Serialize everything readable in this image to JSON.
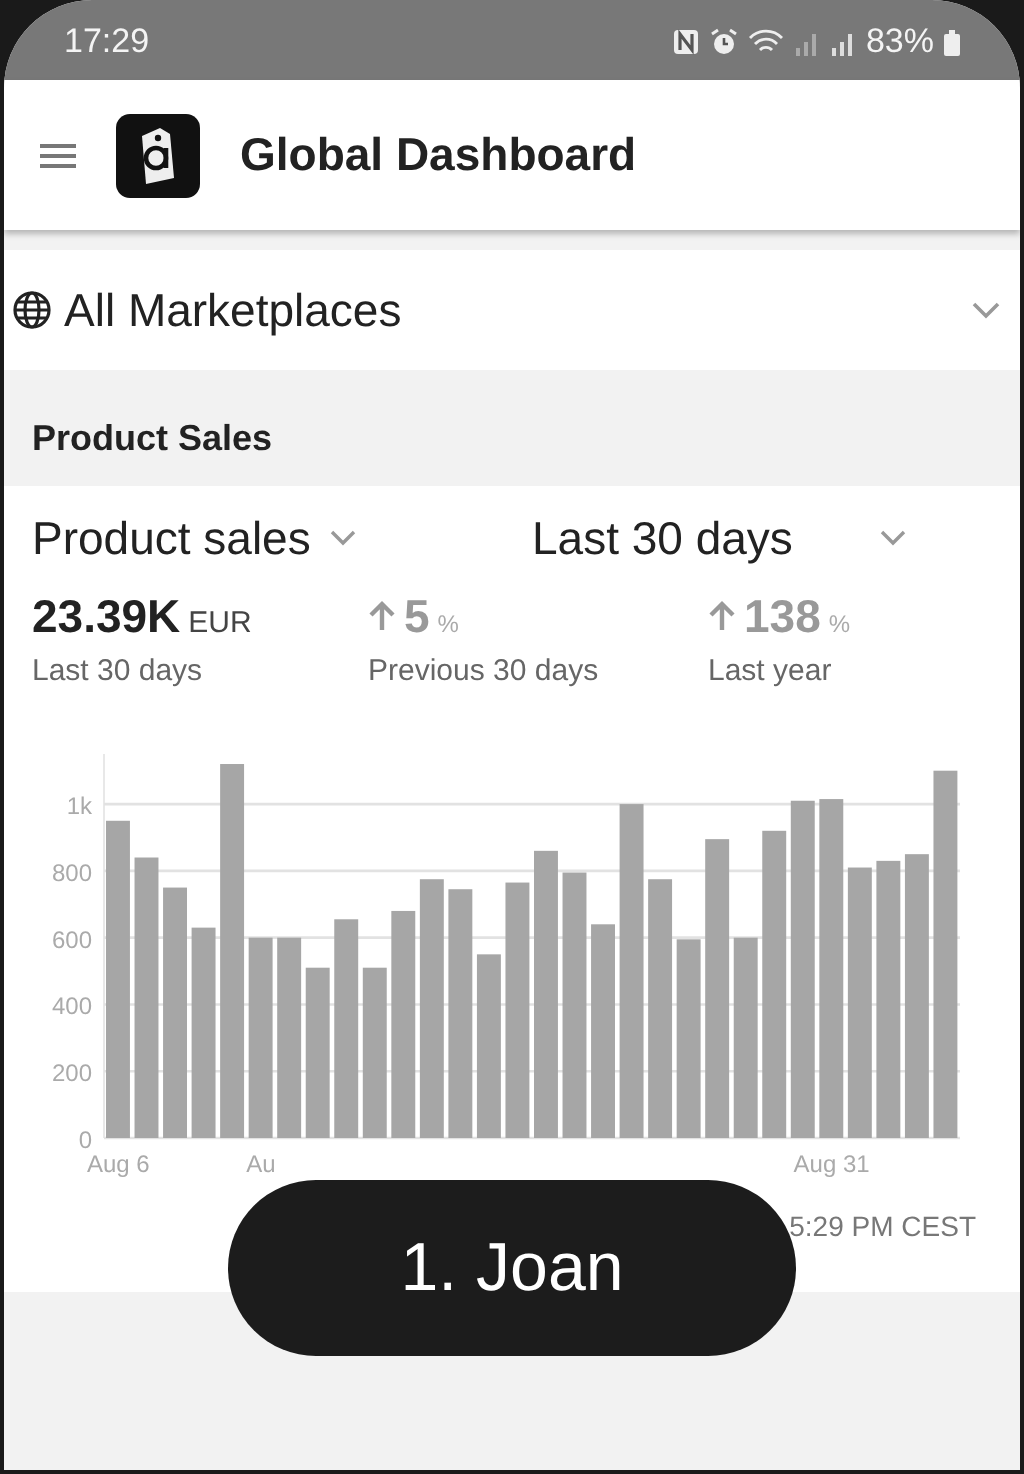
{
  "status_bar": {
    "time": "17:29",
    "battery": "83%"
  },
  "header": {
    "title": "Global Dashboard"
  },
  "marketplace": {
    "label": "All Marketplaces"
  },
  "section": {
    "title": "Product Sales"
  },
  "filters": [
    {
      "label": "Product sales"
    },
    {
      "label": "Last 30 days"
    }
  ],
  "stats": [
    {
      "kind": "total",
      "value": "23.39K",
      "unit": "EUR",
      "caption": "Last 30 days"
    },
    {
      "kind": "increase",
      "value": "5",
      "unit": "%",
      "caption": "Previous 30 days"
    },
    {
      "kind": "increase",
      "value": "138",
      "unit": "%",
      "caption": "Last year"
    }
  ],
  "chart_data": {
    "type": "bar",
    "values": [
      950,
      840,
      750,
      630,
      1120,
      600,
      600,
      510,
      655,
      510,
      680,
      775,
      745,
      550,
      765,
      860,
      795,
      640,
      1000,
      775,
      595,
      895,
      600,
      920,
      1010,
      1015,
      810,
      830,
      850,
      1100
    ],
    "grid": true,
    "ylim": [
      0,
      1150
    ],
    "yticks": [
      0,
      200,
      400,
      600,
      800,
      {
        "value": 1000,
        "label": "1k"
      }
    ],
    "categories": [
      "Aug 6",
      null,
      null,
      null,
      null,
      "Au",
      null,
      null,
      null,
      null,
      null,
      null,
      null,
      null,
      null,
      null,
      null,
      null,
      null,
      null,
      null,
      null,
      null,
      null,
      null,
      "Aug 31",
      null,
      null,
      null,
      null
    ]
  },
  "updated": "5:29 PM CEST",
  "caption": "1. Joan"
}
